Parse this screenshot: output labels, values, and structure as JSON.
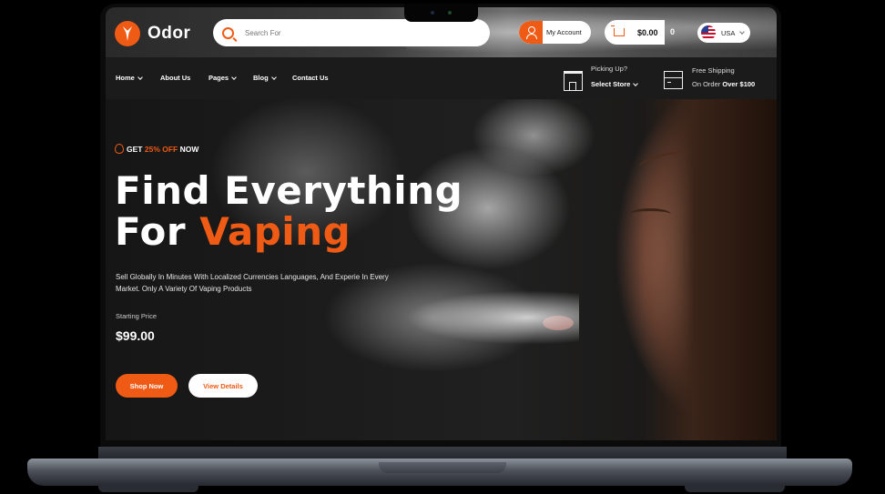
{
  "header": {
    "brand": "Odor",
    "search": {
      "placeholder": "Search For",
      "value": ""
    },
    "account_label": "My Account",
    "cart_total": "$0.00",
    "cart_count": "0",
    "language": "USA"
  },
  "nav": {
    "items": [
      {
        "label": "Home",
        "has_dropdown": true
      },
      {
        "label": "About Us",
        "has_dropdown": false
      },
      {
        "label": "Pages",
        "has_dropdown": true
      },
      {
        "label": "Blog",
        "has_dropdown": true
      },
      {
        "label": "Contact Us",
        "has_dropdown": false
      }
    ],
    "pickup": {
      "title": "Picking Up?",
      "select_label": "Select Store"
    },
    "shipping": {
      "title": "Free Shipping",
      "sub_prefix": "On Order",
      "sub_bold": "Over $100"
    }
  },
  "hero": {
    "offer_prefix": "GET",
    "offer_accent": "25% OFF",
    "offer_suffix": "NOW",
    "title_line1": "Find Everything",
    "title_line2_prefix": "For",
    "title_line2_accent": "Vaping",
    "description": "Sell Globally In Minutes With Localized Currencies Languages, And Experie In Every Market. Only A Variety Of Vaping Products",
    "price_label": "Starting Price",
    "price": "$99.00",
    "primary_button": "Shop Now",
    "secondary_button": "View Details"
  },
  "colors": {
    "accent": "#ef5a14",
    "nav_bg": "#1b1b1b",
    "hero_bg": "#161616"
  }
}
